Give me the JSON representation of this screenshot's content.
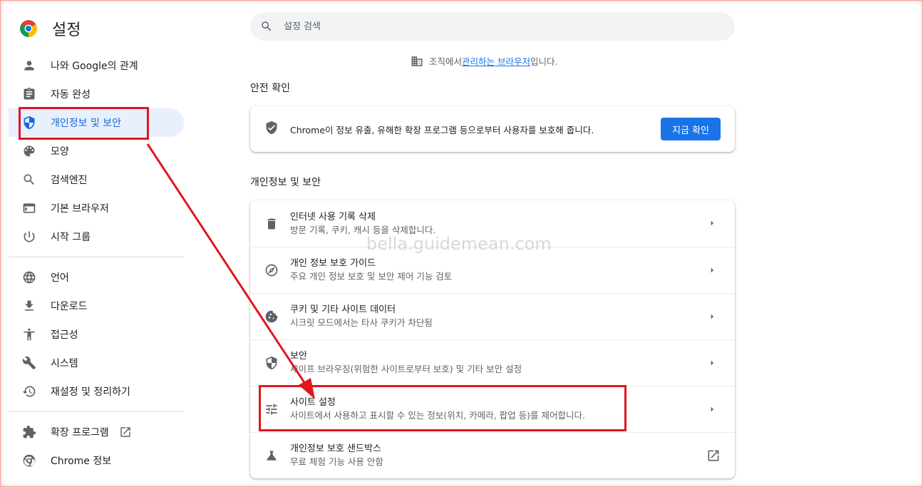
{
  "app": {
    "title": "설정"
  },
  "search": {
    "placeholder": "설정 검색"
  },
  "managed": {
    "prefix": "조직에서 ",
    "link": "관리하는 브라우저",
    "suffix": "입니다."
  },
  "sidebar": {
    "items": [
      {
        "label": "나와 Google의 관계",
        "icon": "person-icon"
      },
      {
        "label": "자동 완성",
        "icon": "clipboard-icon"
      },
      {
        "label": "개인정보 및 보안",
        "icon": "shield-icon"
      },
      {
        "label": "모양",
        "icon": "palette-icon"
      },
      {
        "label": "검색엔진",
        "icon": "search-icon"
      },
      {
        "label": "기본 브라우저",
        "icon": "browser-icon"
      },
      {
        "label": "시작 그룹",
        "icon": "power-icon"
      },
      {
        "label": "언어",
        "icon": "globe-icon"
      },
      {
        "label": "다운로드",
        "icon": "download-icon"
      },
      {
        "label": "접근성",
        "icon": "accessibility-icon"
      },
      {
        "label": "시스템",
        "icon": "wrench-icon"
      },
      {
        "label": "재설정 및 정리하기",
        "icon": "restore-icon"
      },
      {
        "label": "확장 프로그램",
        "icon": "puzzle-icon"
      },
      {
        "label": "Chrome 정보",
        "icon": "chrome-icon"
      }
    ]
  },
  "safety_check": {
    "title": "안전 확인",
    "description": "Chrome이 정보 유출, 유해한 확장 프로그램 등으로부터 사용자를 보호해 줍니다.",
    "button": "지금 확인"
  },
  "privacy": {
    "title": "개인정보 및 보안",
    "rows": [
      {
        "title": "인터넷 사용 기록 삭제",
        "subtitle": "방문 기록, 쿠키, 캐시 등을 삭제합니다.",
        "icon": "trash-icon"
      },
      {
        "title": "개인 정보 보호 가이드",
        "subtitle": "주요 개인 정보 보호 및 보안 제어 기능 검토",
        "icon": "compass-icon"
      },
      {
        "title": "쿠키 및 기타 사이트 데이터",
        "subtitle": "시크릿 모드에서는 타사 쿠키가 차단됨",
        "icon": "cookie-icon"
      },
      {
        "title": "보안",
        "subtitle": "세이프 브라우징(위험한 사이트로부터 보호) 및 기타 보안 설정",
        "icon": "shield-outline-icon"
      },
      {
        "title": "사이트 설정",
        "subtitle": "사이트에서 사용하고 표시할 수 있는 정보(위치, 카메라, 팝업 등)를 제어합니다.",
        "icon": "tune-icon"
      },
      {
        "title": "개인정보 보호 샌드박스",
        "subtitle": "무료 체험 기능 사용 안함",
        "icon": "flask-icon"
      }
    ]
  },
  "watermark": "bella.guidemean.com",
  "colors": {
    "accent": "#1a73e8",
    "active_bg": "#e8f0fe",
    "annotation": "#e0161f"
  }
}
